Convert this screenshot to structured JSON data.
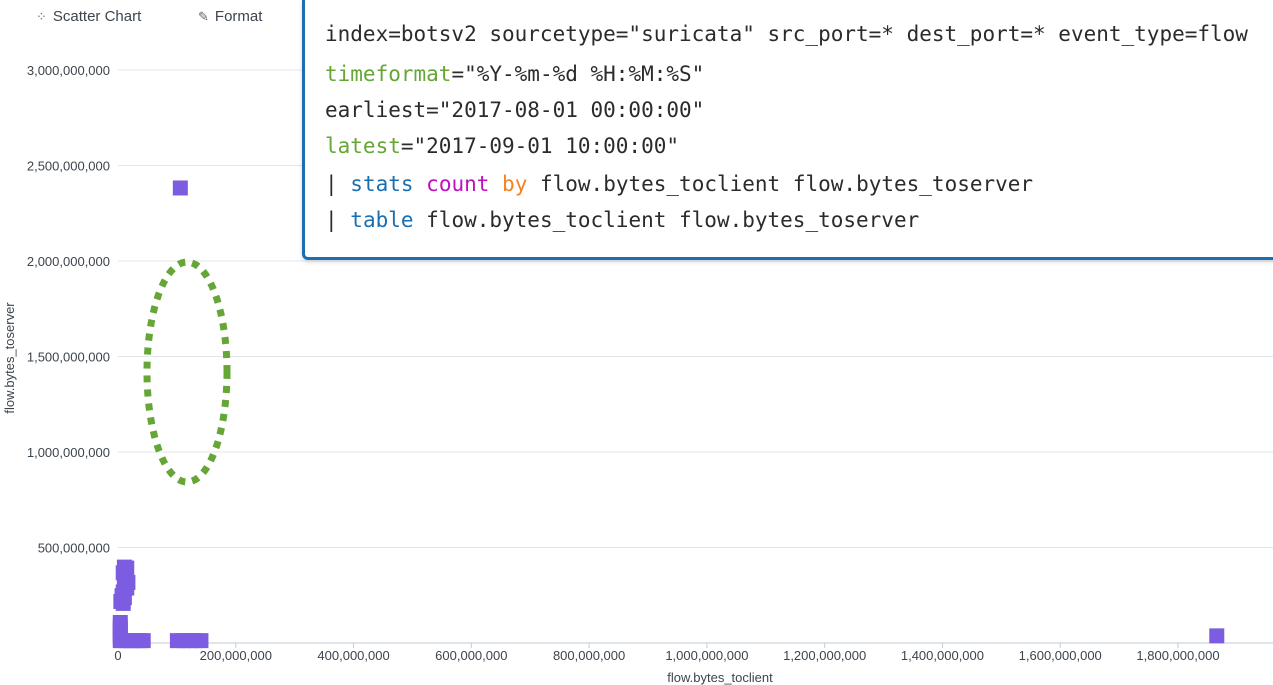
{
  "toolbar": {
    "scatter_label": "Scatter Chart",
    "scatter_icon": "scatter-chart-icon",
    "format_label": "Format",
    "format_icon": "pencil-icon"
  },
  "search": {
    "line1": "index=botsv2 sourcetype=\"suricata\" src_port=* dest_port=* event_type=flow",
    "line2_key": "timeformat",
    "line2_val": "=\"%Y-%m-%d %H:%M:%S\"",
    "line3": "earliest=\"2017-08-01 00:00:00\"",
    "line4_key": "latest",
    "line4_val": "=\"2017-09-01 10:00:00\"",
    "line5_pipe": "| ",
    "line5_cmd": "stats",
    "line5_fn": "count",
    "line5_by": "by",
    "line5_rest": " flow.bytes_toclient flow.bytes_toserver",
    "line6_pipe": "| ",
    "line6_cmd": "table",
    "line6_rest": " flow.bytes_toclient flow.bytes_toserver"
  },
  "colors": {
    "marker": "#7c5ce0",
    "annotation": "#65a637",
    "panel_border": "#1a6fb3",
    "grid": "#e1e6eb"
  },
  "chart_data": {
    "type": "scatter",
    "xlabel": "flow.bytes_toclient",
    "ylabel": "flow.bytes_toserver",
    "xlim": [
      0,
      1920000000
    ],
    "ylim": [
      0,
      3000000000
    ],
    "x_ticks": [
      0,
      200000000,
      400000000,
      600000000,
      800000000,
      1000000000,
      1200000000,
      1400000000,
      1600000000,
      1800000000
    ],
    "x_tick_labels": [
      "0",
      "200,000,000",
      "400,000,000",
      "600,000,000",
      "800,000,000",
      "1,000,000,000",
      "1,200,000,000",
      "1,400,000,000",
      "1,600,000,000",
      "1,800,000,000"
    ],
    "y_ticks": [
      500000000,
      1000000000,
      1500000000,
      2000000000,
      2500000000,
      3000000000
    ],
    "y_tick_labels": [
      "500,000,000",
      "1,000,000,000",
      "1,500,000,000",
      "2,000,000,000",
      "2,500,000,000",
      "3,000,000,000"
    ],
    "grid": true,
    "points": [
      {
        "x": 105000000,
        "y": 2385000000
      },
      {
        "x": 10000000,
        "y": 400000000
      },
      {
        "x": 14000000,
        "y": 395000000
      },
      {
        "x": 8000000,
        "y": 370000000
      },
      {
        "x": 12000000,
        "y": 340000000
      },
      {
        "x": 16000000,
        "y": 320000000
      },
      {
        "x": 10000000,
        "y": 300000000
      },
      {
        "x": 14000000,
        "y": 290000000
      },
      {
        "x": 8000000,
        "y": 270000000
      },
      {
        "x": 6000000,
        "y": 250000000
      },
      {
        "x": 10000000,
        "y": 240000000
      },
      {
        "x": 4000000,
        "y": 220000000
      },
      {
        "x": 8000000,
        "y": 210000000
      },
      {
        "x": 3000000,
        "y": 110000000
      },
      {
        "x": 3000000,
        "y": 90000000
      },
      {
        "x": 3000000,
        "y": 70000000
      },
      {
        "x": 3000000,
        "y": 50000000
      },
      {
        "x": 3000000,
        "y": 30000000
      },
      {
        "x": 3000000,
        "y": 15000000
      },
      {
        "x": 12000000,
        "y": 15000000
      },
      {
        "x": 20000000,
        "y": 15000000
      },
      {
        "x": 28000000,
        "y": 15000000
      },
      {
        "x": 36000000,
        "y": 15000000
      },
      {
        "x": 42000000,
        "y": 15000000
      },
      {
        "x": 100000000,
        "y": 15000000
      },
      {
        "x": 110000000,
        "y": 15000000
      },
      {
        "x": 120000000,
        "y": 15000000
      },
      {
        "x": 130000000,
        "y": 15000000
      },
      {
        "x": 140000000,
        "y": 15000000
      },
      {
        "x": 1865000000,
        "y": 40000000
      }
    ]
  }
}
